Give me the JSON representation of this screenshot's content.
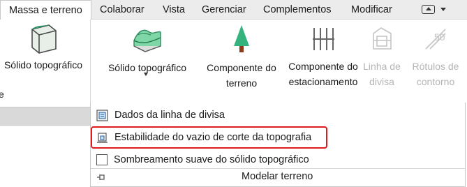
{
  "tabs": {
    "active": "Massa e terreno",
    "items": [
      "Colaborar",
      "Vista",
      "Gerenciar",
      "Complementos",
      "Modificar"
    ]
  },
  "ribbon": {
    "left_panel_button": "Sólido topográfico",
    "left_panel_title_fragment": "e",
    "toposolid_dropdown": "Sólido topográfico",
    "site_component": [
      "Componente do",
      "terreno"
    ],
    "parking_component": [
      "Componente do",
      "estacionamento"
    ],
    "property_line": [
      "Linha de",
      "divisa"
    ],
    "contour_labels": [
      "Rótulos de",
      "contorno"
    ]
  },
  "menu": {
    "items": [
      "Dados da linha de divisa",
      "Estabilidade do vazio de corte da topografia",
      "Sombreamento suave do sólido topográfico"
    ],
    "panel_title": "Modelar terreno"
  },
  "colors": {
    "highlight": "#e01b1b",
    "tree_green": "#35b37e",
    "tree_trunk": "#8b3a1a"
  }
}
